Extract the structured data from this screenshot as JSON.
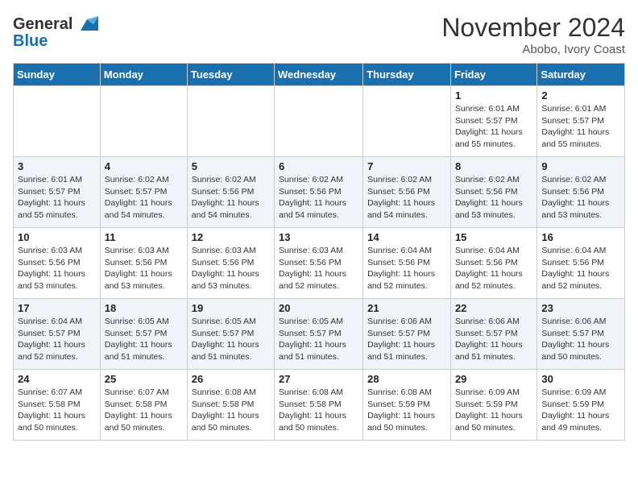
{
  "header": {
    "logo_line1": "General",
    "logo_line2": "Blue",
    "month": "November 2024",
    "location": "Abobo, Ivory Coast"
  },
  "weekdays": [
    "Sunday",
    "Monday",
    "Tuesday",
    "Wednesday",
    "Thursday",
    "Friday",
    "Saturday"
  ],
  "weeks": [
    [
      {
        "day": "",
        "info": ""
      },
      {
        "day": "",
        "info": ""
      },
      {
        "day": "",
        "info": ""
      },
      {
        "day": "",
        "info": ""
      },
      {
        "day": "",
        "info": ""
      },
      {
        "day": "1",
        "info": "Sunrise: 6:01 AM\nSunset: 5:57 PM\nDaylight: 11 hours\nand 55 minutes."
      },
      {
        "day": "2",
        "info": "Sunrise: 6:01 AM\nSunset: 5:57 PM\nDaylight: 11 hours\nand 55 minutes."
      }
    ],
    [
      {
        "day": "3",
        "info": "Sunrise: 6:01 AM\nSunset: 5:57 PM\nDaylight: 11 hours\nand 55 minutes."
      },
      {
        "day": "4",
        "info": "Sunrise: 6:02 AM\nSunset: 5:57 PM\nDaylight: 11 hours\nand 54 minutes."
      },
      {
        "day": "5",
        "info": "Sunrise: 6:02 AM\nSunset: 5:56 PM\nDaylight: 11 hours\nand 54 minutes."
      },
      {
        "day": "6",
        "info": "Sunrise: 6:02 AM\nSunset: 5:56 PM\nDaylight: 11 hours\nand 54 minutes."
      },
      {
        "day": "7",
        "info": "Sunrise: 6:02 AM\nSunset: 5:56 PM\nDaylight: 11 hours\nand 54 minutes."
      },
      {
        "day": "8",
        "info": "Sunrise: 6:02 AM\nSunset: 5:56 PM\nDaylight: 11 hours\nand 53 minutes."
      },
      {
        "day": "9",
        "info": "Sunrise: 6:02 AM\nSunset: 5:56 PM\nDaylight: 11 hours\nand 53 minutes."
      }
    ],
    [
      {
        "day": "10",
        "info": "Sunrise: 6:03 AM\nSunset: 5:56 PM\nDaylight: 11 hours\nand 53 minutes."
      },
      {
        "day": "11",
        "info": "Sunrise: 6:03 AM\nSunset: 5:56 PM\nDaylight: 11 hours\nand 53 minutes."
      },
      {
        "day": "12",
        "info": "Sunrise: 6:03 AM\nSunset: 5:56 PM\nDaylight: 11 hours\nand 53 minutes."
      },
      {
        "day": "13",
        "info": "Sunrise: 6:03 AM\nSunset: 5:56 PM\nDaylight: 11 hours\nand 52 minutes."
      },
      {
        "day": "14",
        "info": "Sunrise: 6:04 AM\nSunset: 5:56 PM\nDaylight: 11 hours\nand 52 minutes."
      },
      {
        "day": "15",
        "info": "Sunrise: 6:04 AM\nSunset: 5:56 PM\nDaylight: 11 hours\nand 52 minutes."
      },
      {
        "day": "16",
        "info": "Sunrise: 6:04 AM\nSunset: 5:56 PM\nDaylight: 11 hours\nand 52 minutes."
      }
    ],
    [
      {
        "day": "17",
        "info": "Sunrise: 6:04 AM\nSunset: 5:57 PM\nDaylight: 11 hours\nand 52 minutes."
      },
      {
        "day": "18",
        "info": "Sunrise: 6:05 AM\nSunset: 5:57 PM\nDaylight: 11 hours\nand 51 minutes."
      },
      {
        "day": "19",
        "info": "Sunrise: 6:05 AM\nSunset: 5:57 PM\nDaylight: 11 hours\nand 51 minutes."
      },
      {
        "day": "20",
        "info": "Sunrise: 6:05 AM\nSunset: 5:57 PM\nDaylight: 11 hours\nand 51 minutes."
      },
      {
        "day": "21",
        "info": "Sunrise: 6:06 AM\nSunset: 5:57 PM\nDaylight: 11 hours\nand 51 minutes."
      },
      {
        "day": "22",
        "info": "Sunrise: 6:06 AM\nSunset: 5:57 PM\nDaylight: 11 hours\nand 51 minutes."
      },
      {
        "day": "23",
        "info": "Sunrise: 6:06 AM\nSunset: 5:57 PM\nDaylight: 11 hours\nand 50 minutes."
      }
    ],
    [
      {
        "day": "24",
        "info": "Sunrise: 6:07 AM\nSunset: 5:58 PM\nDaylight: 11 hours\nand 50 minutes."
      },
      {
        "day": "25",
        "info": "Sunrise: 6:07 AM\nSunset: 5:58 PM\nDaylight: 11 hours\nand 50 minutes."
      },
      {
        "day": "26",
        "info": "Sunrise: 6:08 AM\nSunset: 5:58 PM\nDaylight: 11 hours\nand 50 minutes."
      },
      {
        "day": "27",
        "info": "Sunrise: 6:08 AM\nSunset: 5:58 PM\nDaylight: 11 hours\nand 50 minutes."
      },
      {
        "day": "28",
        "info": "Sunrise: 6:08 AM\nSunset: 5:59 PM\nDaylight: 11 hours\nand 50 minutes."
      },
      {
        "day": "29",
        "info": "Sunrise: 6:09 AM\nSunset: 5:59 PM\nDaylight: 11 hours\nand 50 minutes."
      },
      {
        "day": "30",
        "info": "Sunrise: 6:09 AM\nSunset: 5:59 PM\nDaylight: 11 hours\nand 49 minutes."
      }
    ]
  ]
}
